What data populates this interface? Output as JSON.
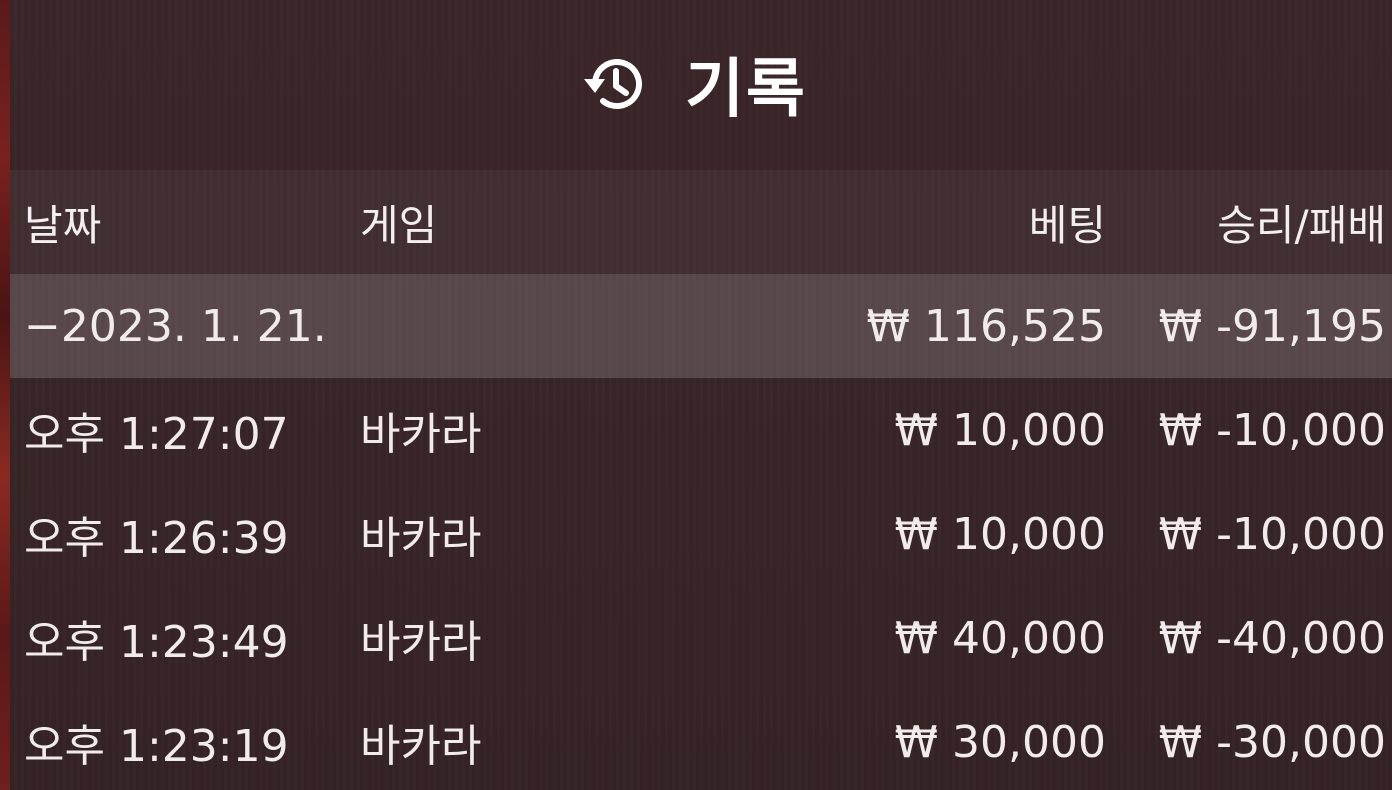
{
  "header": {
    "title": "기록",
    "icon": "history-icon"
  },
  "columns": {
    "date": "날짜",
    "game": "게임",
    "bet": "베팅",
    "win_loss": "승리/패배"
  },
  "summary": {
    "date": "−2023. 1. 21.",
    "bet": "₩ 116,525",
    "win_loss": "₩ -91,195"
  },
  "rows": [
    {
      "time": "오후 1:27:07",
      "game": "바카라",
      "bet": "₩ 10,000",
      "win_loss": "₩ -10,000"
    },
    {
      "time": "오후 1:26:39",
      "game": "바카라",
      "bet": "₩ 10,000",
      "win_loss": "₩ -10,000"
    },
    {
      "time": "오후 1:23:49",
      "game": "바카라",
      "bet": "₩ 40,000",
      "win_loss": "₩ -40,000"
    },
    {
      "time": "오후 1:23:19",
      "game": "바카라",
      "bet": "₩ 30,000",
      "win_loss": "₩ -30,000"
    }
  ],
  "colors": {
    "background": "#3a2629",
    "text": "#f1ebeb",
    "date_row_highlight": "#5a4a4c"
  }
}
